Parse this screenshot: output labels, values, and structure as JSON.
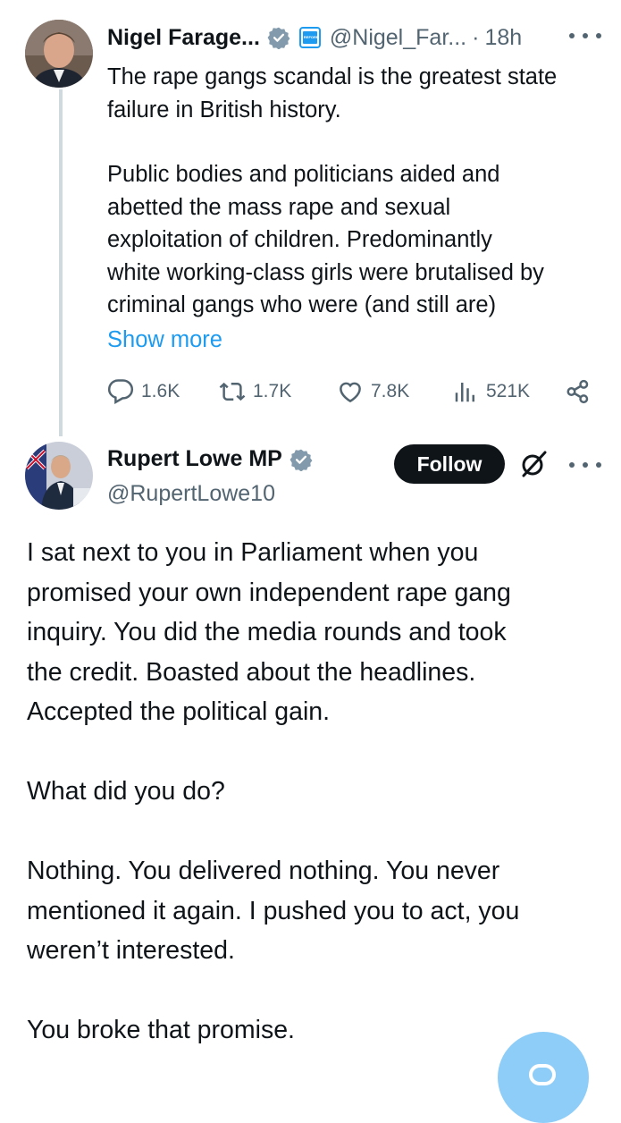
{
  "parent": {
    "name": "Nigel Farage...",
    "handle": "@Nigel_Far...",
    "separator": "·",
    "time": "18h",
    "text_lines_1": [
      "The rape gangs scandal is the greatest state",
      "failure in British history."
    ],
    "text_lines_2": [
      "Public bodies and politicians aided and",
      "abetted the mass rape and sexual",
      "exploitation of children. Predominantly",
      "white working-class girls were brutalised by",
      "criminal gangs who were (and still are)"
    ],
    "show_more": "Show more",
    "metrics": {
      "replies": "1.6K",
      "reposts": "1.7K",
      "likes": "7.8K",
      "views": "521K"
    }
  },
  "main": {
    "name": "Rupert Lowe MP",
    "handle": "@RupertLowe10",
    "follow_label": "Follow",
    "paragraphs": [
      [
        "I sat next to you in Parliament when you",
        "promised your own independent rape gang",
        "inquiry. You did the media rounds and took",
        "the credit. Boasted about the headlines.",
        "Accepted the political gain."
      ],
      [
        "What did you do?"
      ],
      [
        "Nothing. You delivered nothing. You never",
        "mentioned it again. I pushed you to act, you",
        "weren’t interested."
      ],
      [
        "You broke that promise."
      ]
    ]
  },
  "icons": {
    "verified": "verified-badge-icon",
    "affiliation": "reform-affiliate-badge-icon",
    "more": "more-icon",
    "reply": "reply-icon",
    "repost": "repost-icon",
    "like": "like-icon",
    "views": "views-icon",
    "share": "share-icon",
    "grok": "grok-icon",
    "compose": "compose-fab-icon"
  },
  "colors": {
    "accent": "#1d9bf0",
    "text": "#0f1419",
    "muted": "#536471",
    "thread_line": "#cfd9de",
    "fab": "#8ecdf8"
  }
}
